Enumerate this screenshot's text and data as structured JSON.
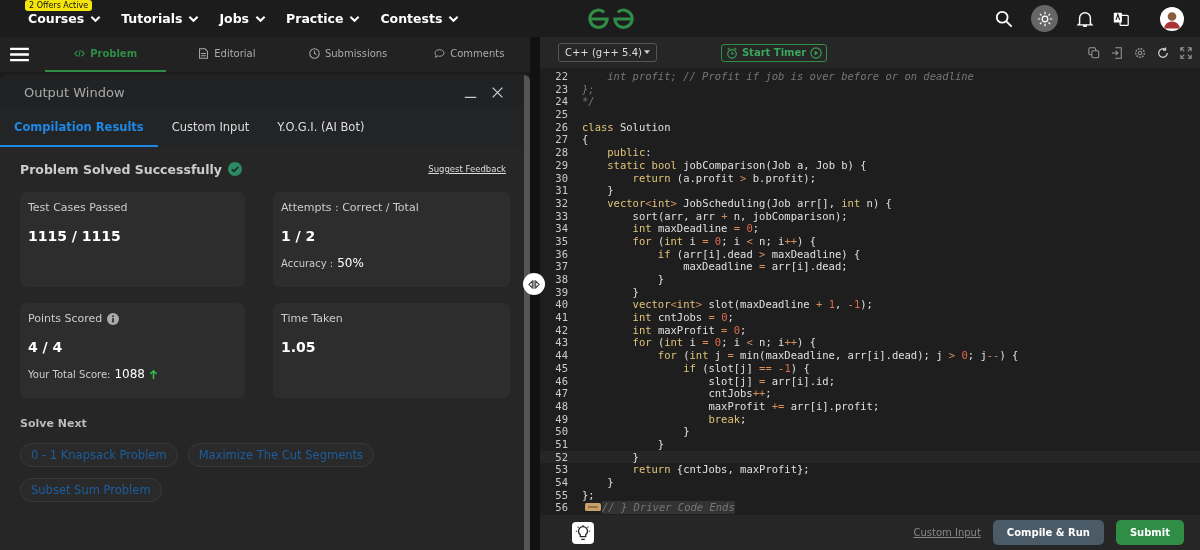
{
  "nav": {
    "offer_badge": "2 Offers Active",
    "items": [
      {
        "label": "Courses"
      },
      {
        "label": "Tutorials"
      },
      {
        "label": "Jobs"
      },
      {
        "label": "Practice"
      },
      {
        "label": "Contests"
      }
    ]
  },
  "problem_tabs": [
    {
      "label": "Problem",
      "selected": true
    },
    {
      "label": "Editorial",
      "selected": false
    },
    {
      "label": "Submissions",
      "selected": false
    },
    {
      "label": "Comments",
      "selected": false
    }
  ],
  "output_window": {
    "title": "Output Window",
    "tabs": [
      {
        "label": "Compilation Results",
        "selected": true
      },
      {
        "label": "Custom Input",
        "selected": false
      },
      {
        "label": "Y.O.G.I. (AI Bot)",
        "selected": false
      }
    ],
    "status": "Problem Solved Successfully",
    "feedback_link": "Suggest Feedback",
    "cards": [
      {
        "label": "Test Cases Passed",
        "value": "1115 / 1115"
      },
      {
        "label": "Attempts : Correct / Total",
        "value": "1 / 2",
        "extra_label": "Accuracy :",
        "extra_value": "50%"
      },
      {
        "label": "Points Scored",
        "info": true,
        "value": "4 / 4",
        "extra_label": "Your Total Score:",
        "extra_value": "1088",
        "trend_up": true
      },
      {
        "label": "Time Taken",
        "value": "1.05"
      }
    ],
    "solve_next_title": "Solve Next",
    "solve_next": [
      "0 - 1 Knapsack Problem",
      "Maximize The Cut Segments",
      "Subset Sum Problem"
    ]
  },
  "editor": {
    "language": "C++ (g++ 5.4)",
    "timer_button": "Start Timer",
    "lines": [
      {
        "n": "22",
        "kind": "comment",
        "text": "    int profit; // Profit if job is over before or on deadline"
      },
      {
        "n": "23",
        "kind": "comment",
        "text": "};"
      },
      {
        "n": "24",
        "kind": "comment",
        "text": "*/"
      },
      {
        "n": "25",
        "kind": "blank"
      },
      {
        "n": "26",
        "kind": "code",
        "text": "class Solution"
      },
      {
        "n": "27",
        "kind": "code",
        "text": "{"
      },
      {
        "n": "28",
        "kind": "code",
        "text": "    public:"
      },
      {
        "n": "29",
        "kind": "code",
        "text": "    static bool jobComparison(Job a, Job b) {"
      },
      {
        "n": "30",
        "kind": "code",
        "text": "        return (a.profit > b.profit);"
      },
      {
        "n": "31",
        "kind": "code",
        "text": "    }"
      },
      {
        "n": "32",
        "kind": "code",
        "text": "    vector<int> JobScheduling(Job arr[], int n) {"
      },
      {
        "n": "33",
        "kind": "code",
        "text": "        sort(arr, arr + n, jobComparison);"
      },
      {
        "n": "34",
        "kind": "code",
        "text": "        int maxDeadline = 0;"
      },
      {
        "n": "35",
        "kind": "code",
        "text": "        for (int i = 0; i < n; i++) {"
      },
      {
        "n": "36",
        "kind": "code",
        "text": "            if (arr[i].dead > maxDeadline) {"
      },
      {
        "n": "37",
        "kind": "code",
        "text": "                maxDeadline = arr[i].dead;"
      },
      {
        "n": "38",
        "kind": "code",
        "text": "            }"
      },
      {
        "n": "39",
        "kind": "code",
        "text": "        }"
      },
      {
        "n": "40",
        "kind": "code",
        "text": "        vector<int> slot(maxDeadline + 1, -1);"
      },
      {
        "n": "41",
        "kind": "code",
        "text": "        int cntJobs = 0;"
      },
      {
        "n": "42",
        "kind": "code",
        "text": "        int maxProfit = 0;"
      },
      {
        "n": "43",
        "kind": "code",
        "text": "        for (int i = 0; i < n; i++) {"
      },
      {
        "n": "44",
        "kind": "code",
        "text": "            for (int j = min(maxDeadline, arr[i].dead); j > 0; j--) {"
      },
      {
        "n": "45",
        "kind": "code",
        "text": "                if (slot[j] == -1) {"
      },
      {
        "n": "46",
        "kind": "code",
        "text": "                    slot[j] = arr[i].id;"
      },
      {
        "n": "47",
        "kind": "code",
        "text": "                    cntJobs++;"
      },
      {
        "n": "48",
        "kind": "code",
        "text": "                    maxProfit += arr[i].profit;"
      },
      {
        "n": "49",
        "kind": "code",
        "text": "                    break;"
      },
      {
        "n": "50",
        "kind": "code",
        "text": "                }"
      },
      {
        "n": "51",
        "kind": "code",
        "text": "            }"
      },
      {
        "n": "52",
        "kind": "code",
        "text": "        }",
        "selected": true
      },
      {
        "n": "53",
        "kind": "code",
        "text": "        return {cntJobs, maxProfit};"
      },
      {
        "n": "54",
        "kind": "code",
        "text": "    }"
      },
      {
        "n": "55",
        "kind": "code",
        "text": "};"
      },
      {
        "n": "56",
        "kind": "folded",
        "text": "// } Driver Code Ends"
      }
    ],
    "custom_input_link": "Custom Input",
    "compile_button": "Compile & Run",
    "submit_button": "Submit"
  }
}
